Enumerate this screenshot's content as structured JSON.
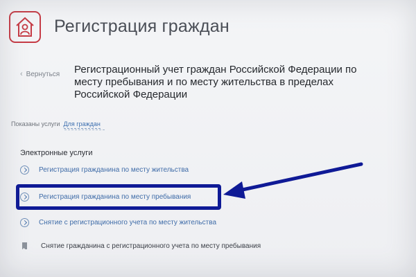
{
  "header": {
    "title": "Регистрация граждан",
    "logo_icon": "house-person-icon",
    "logo_color": "#c63b45"
  },
  "back": {
    "label": "Вернуться",
    "icon": "chevron-left-icon"
  },
  "page_title": "Регистрационный учет граждан Российской Федерации по месту пребывания и по месту жительства в пределах Российской Федерации",
  "filter": {
    "label": "Показаны услуги",
    "value": "Для граждан"
  },
  "services": {
    "section_title": "Электронные услуги",
    "items": [
      {
        "label": "Регистрация гражданина по месту жительства",
        "icon": "chevron-circle-icon"
      },
      {
        "label": "Регистрация гражданина по месту пребывания",
        "icon": "chevron-circle-icon"
      },
      {
        "label": "Снятие с регистрационного учета по месту жительства",
        "icon": "chevron-circle-icon"
      },
      {
        "label": "Снятие гражданина с регистрационного учета по месту пребывания",
        "icon": "bookmark-icon"
      }
    ]
  },
  "annotation": {
    "color": "#0f1a96",
    "highlight_target": "Регистрация гражданина по месту пребывания"
  }
}
